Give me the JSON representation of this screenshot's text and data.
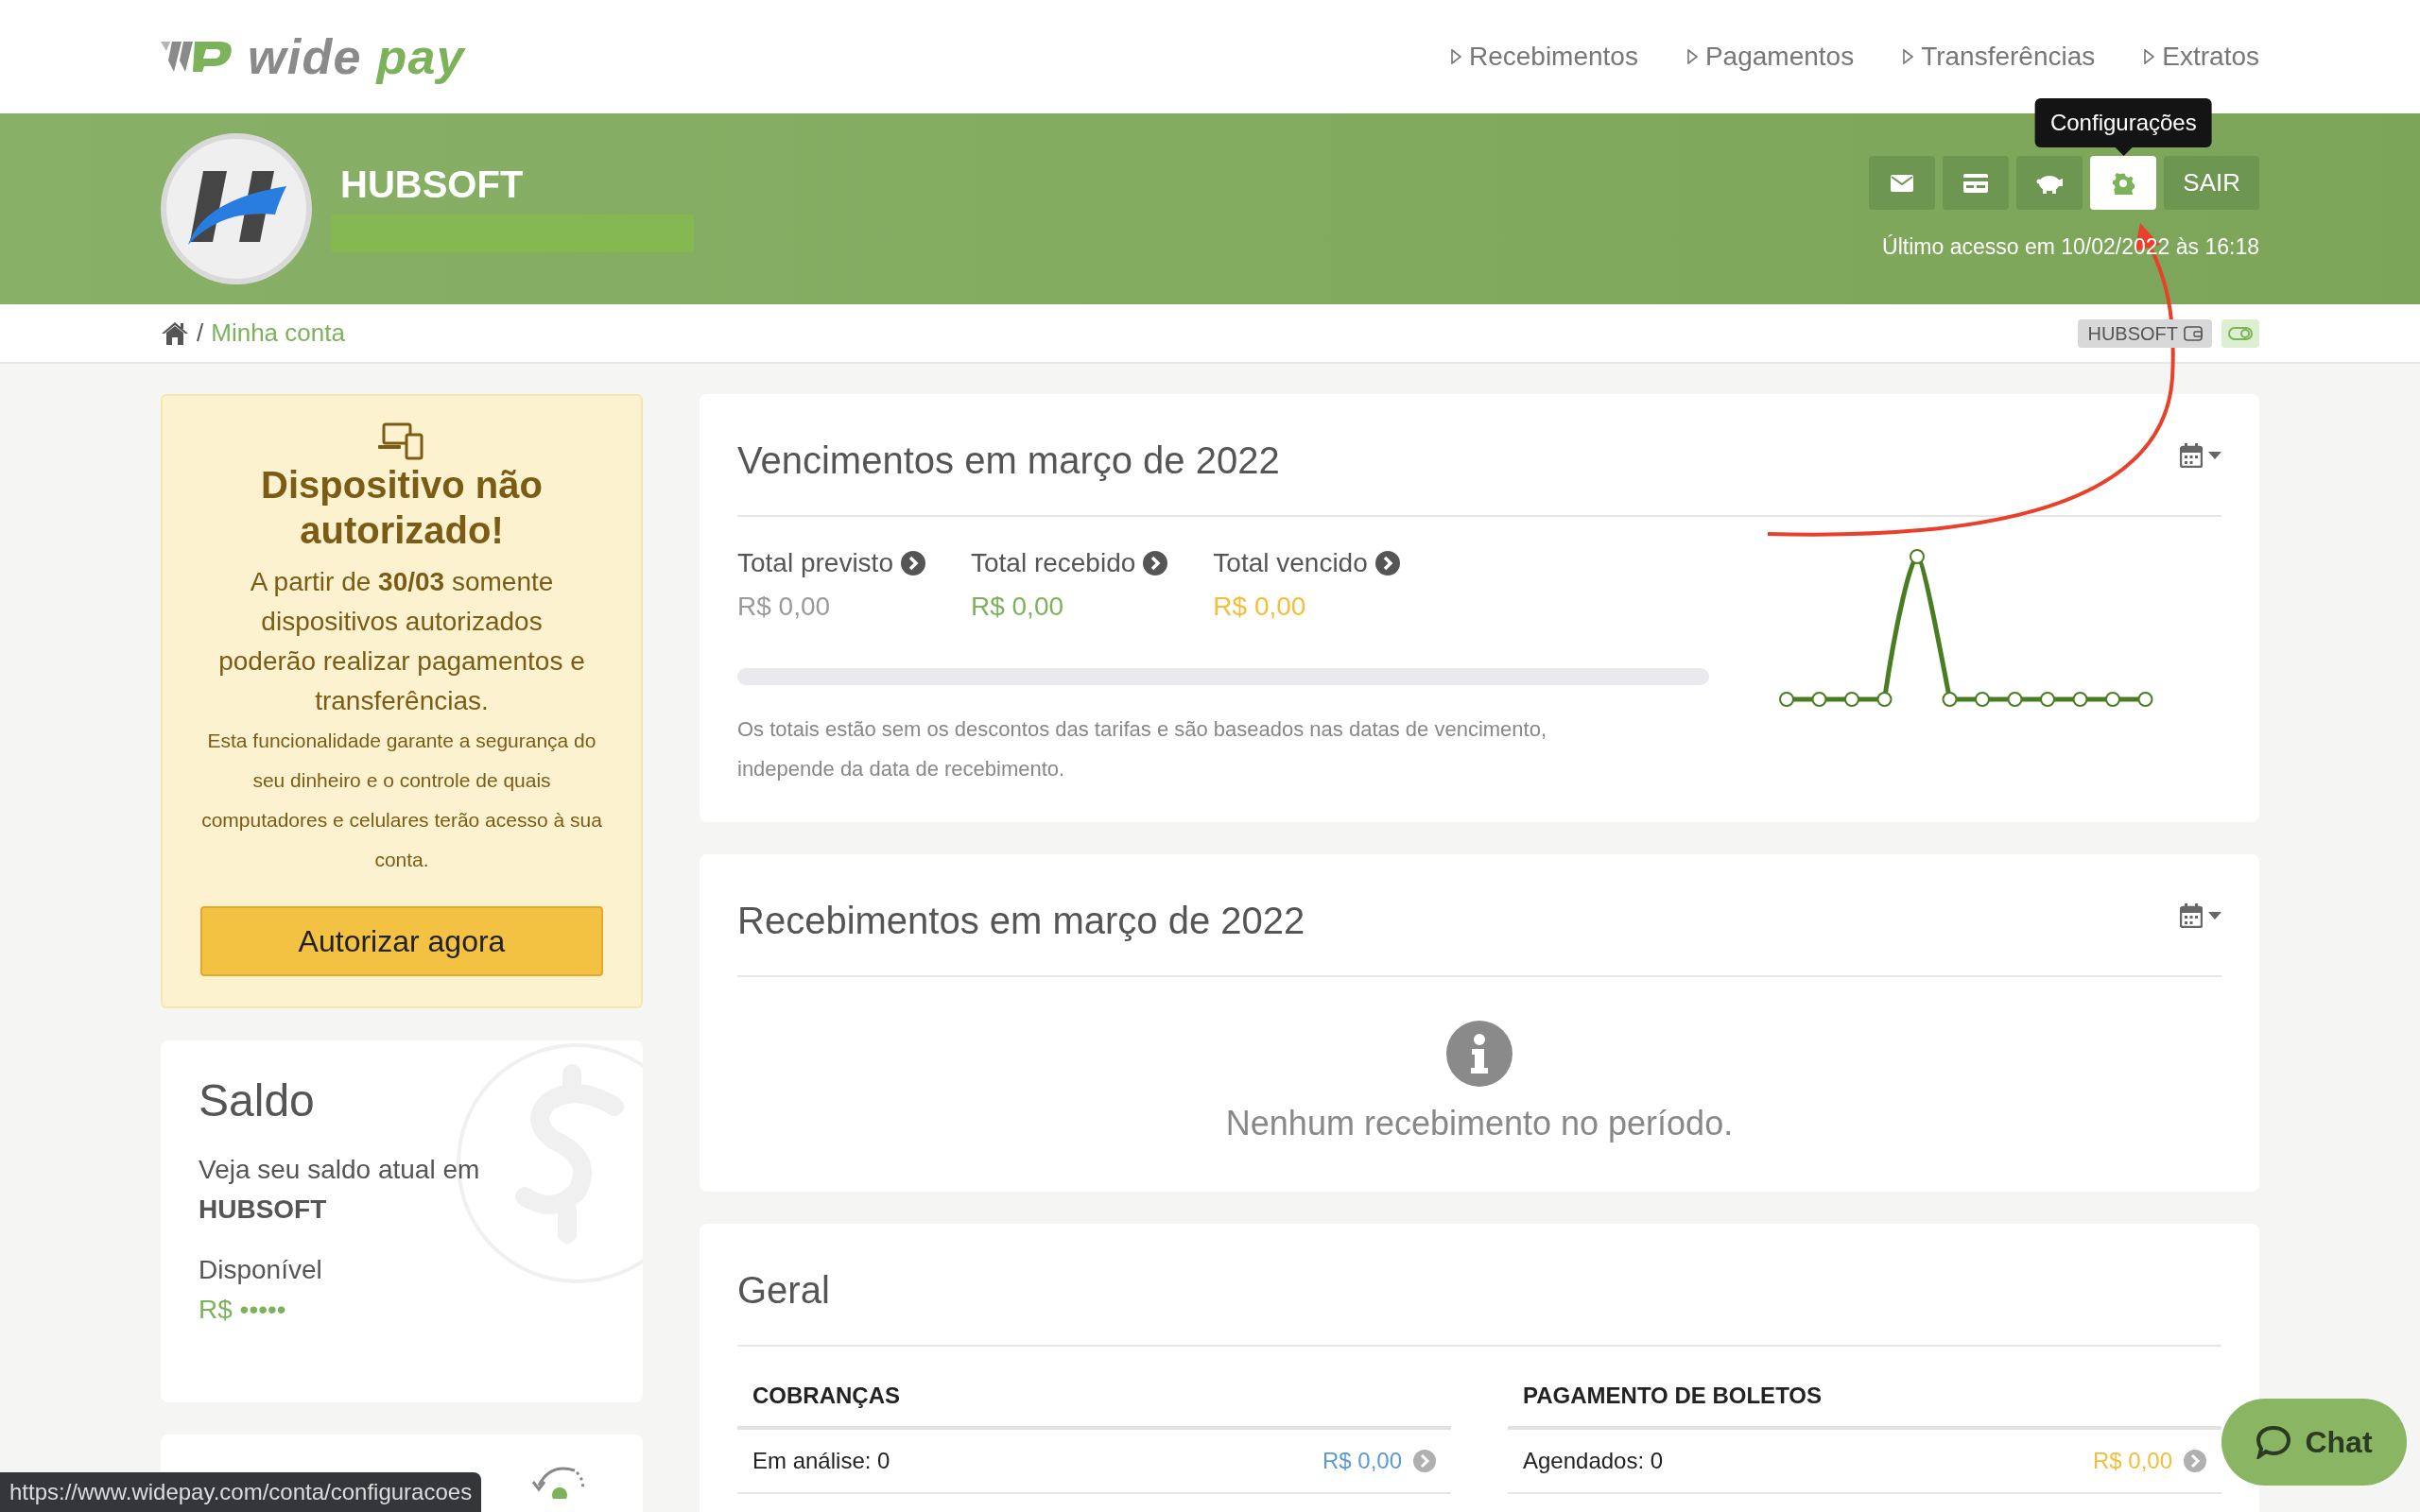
{
  "brand": {
    "word_1": "wide",
    "word_2": "pay"
  },
  "nav": [
    {
      "label": "Recebimentos"
    },
    {
      "label": "Pagamentos"
    },
    {
      "label": "Transferências"
    },
    {
      "label": "Extratos"
    }
  ],
  "account": {
    "name": "HUBSOFT",
    "last_access": "Último acesso em 10/02/2022 às 16:18"
  },
  "toolbar": {
    "tooltip": "Configurações",
    "buttons": [
      {
        "kind": "icon",
        "selected": false
      },
      {
        "kind": "icon",
        "selected": false
      },
      {
        "kind": "icon",
        "selected": false
      },
      {
        "kind": "icon",
        "selected": true
      },
      {
        "kind": "text",
        "label": "SAIR",
        "selected": false
      }
    ]
  },
  "breadcrumb": {
    "separator": "/",
    "current": "Minha conta",
    "account_badge": "HUBSOFT"
  },
  "device_warning": {
    "title": "Dispositivo não autorizado!",
    "message": "A partir de **30/03** somente dispositivos autorizados poderão realizar pagamentos e transferências.",
    "detail": "Esta funcionalidade garante a segurança do seu dinheiro e o controle de quais computadores e celulares terão acesso à sua conta.",
    "button": "Autorizar agora"
  },
  "balance": {
    "title": "Saldo",
    "description": "Veja seu saldo atual em",
    "account": "HUBSOFT",
    "available_label": "Disponível",
    "available_value": "R$ •••••"
  },
  "due_card": {
    "title": "Vencimentos em março de 2022",
    "totals": [
      {
        "label": "Total previsto",
        "value": "R$ 0,00",
        "color": "#9a9a9a"
      },
      {
        "label": "Total recebido",
        "value": "R$ 0,00",
        "color": "#7cb35a"
      },
      {
        "label": "Total vencido",
        "value": "R$ 0,00",
        "color": "#f4bd3a"
      }
    ],
    "progress": {
      "level": 0
    },
    "note": "Os totais estão sem os descontos das tarifas e são baseados nas datas de vencimento, independe da data de recebimento."
  },
  "receipts_card": {
    "title": "Recebimentos em março de 2022",
    "empty_message": "Nenhum recebimento no período."
  },
  "general": {
    "title": "Geral",
    "sections": [
      {
        "heading": "COBRANÇAS",
        "rows": [
          {
            "label": "Em análise: 0",
            "value": "R$ 0,00",
            "color": "#5b9bd5"
          }
        ]
      },
      {
        "heading": "PAGAMENTO DE BOLETOS",
        "rows": [
          {
            "label": "Agendados: 0",
            "value": "R$ 0,00",
            "color": "#f4bd3a"
          }
        ]
      }
    ]
  },
  "chat": {
    "label": "Chat"
  },
  "status_url": "https://www.widepay.com/conta/configuracoes"
}
